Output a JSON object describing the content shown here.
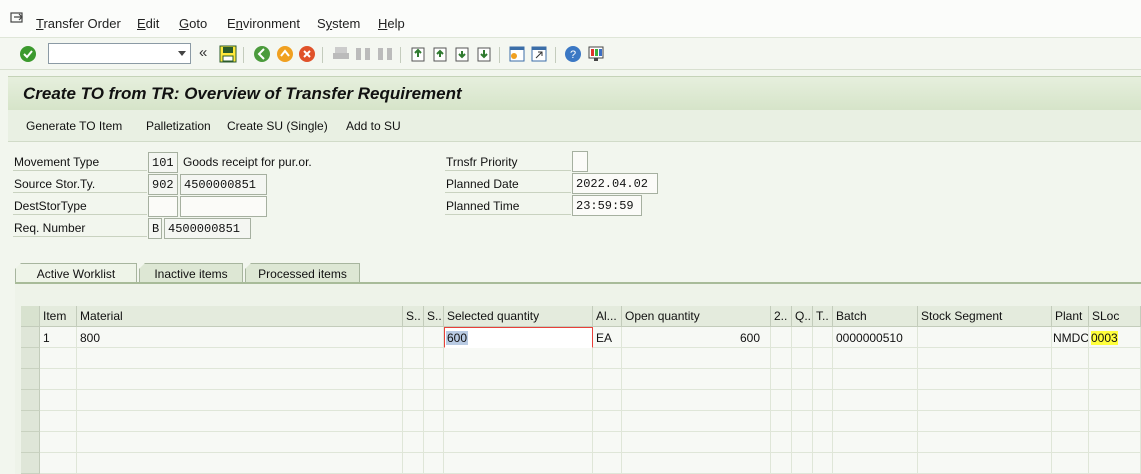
{
  "menubar": {
    "items": [
      "Transfer Order",
      "Edit",
      "Goto",
      "Environment",
      "System",
      "Help"
    ],
    "underline": [
      "T",
      "E",
      "G",
      "n",
      "y",
      "H"
    ]
  },
  "toolbar": {
    "command_value": "",
    "prev_glyph": "«"
  },
  "title": "Create TO from TR: Overview of Transfer Requirement",
  "app_toolbar": [
    "Generate TO Item",
    "Palletization",
    "Create SU (Single)",
    "Add to SU"
  ],
  "header": {
    "movement_type_label": "Movement Type",
    "movement_type_value": "101",
    "movement_type_text": "Goods receipt for pur.or.",
    "source_stor_label": "Source Stor.Ty.",
    "source_stor_value": "902",
    "source_stor_bin": "4500000851",
    "dest_stor_label": "DestStorType",
    "dest_stor_value": "",
    "dest_stor_bin": "",
    "req_number_label": "Req. Number",
    "req_number_type": "B",
    "req_number_value": "4500000851",
    "priority_label": "Trnsfr Priority",
    "priority_value": "",
    "planned_date_label": "Planned Date",
    "planned_date_value": "2022.04.02",
    "planned_time_label": "Planned Time",
    "planned_time_value": "23:59:59"
  },
  "tabs": [
    "Active Worklist",
    "Inactive items",
    "Processed items"
  ],
  "table": {
    "columns": [
      "Item",
      "Material",
      "S..",
      "S..",
      "Selected quantity",
      "Al...",
      "Open quantity",
      "2..",
      "Q...",
      "T..",
      "Batch",
      "Stock Segment",
      "Plant",
      "SLoc"
    ],
    "row": {
      "item": "1",
      "material": "800",
      "selected_quantity": "600",
      "unit": "EA",
      "open_quantity": "600",
      "batch": "0000000510",
      "plant": "NMDC",
      "sloc": "0003"
    }
  },
  "colors": {
    "accent": "#d7e5c9",
    "highlight": "#ffff3c"
  }
}
